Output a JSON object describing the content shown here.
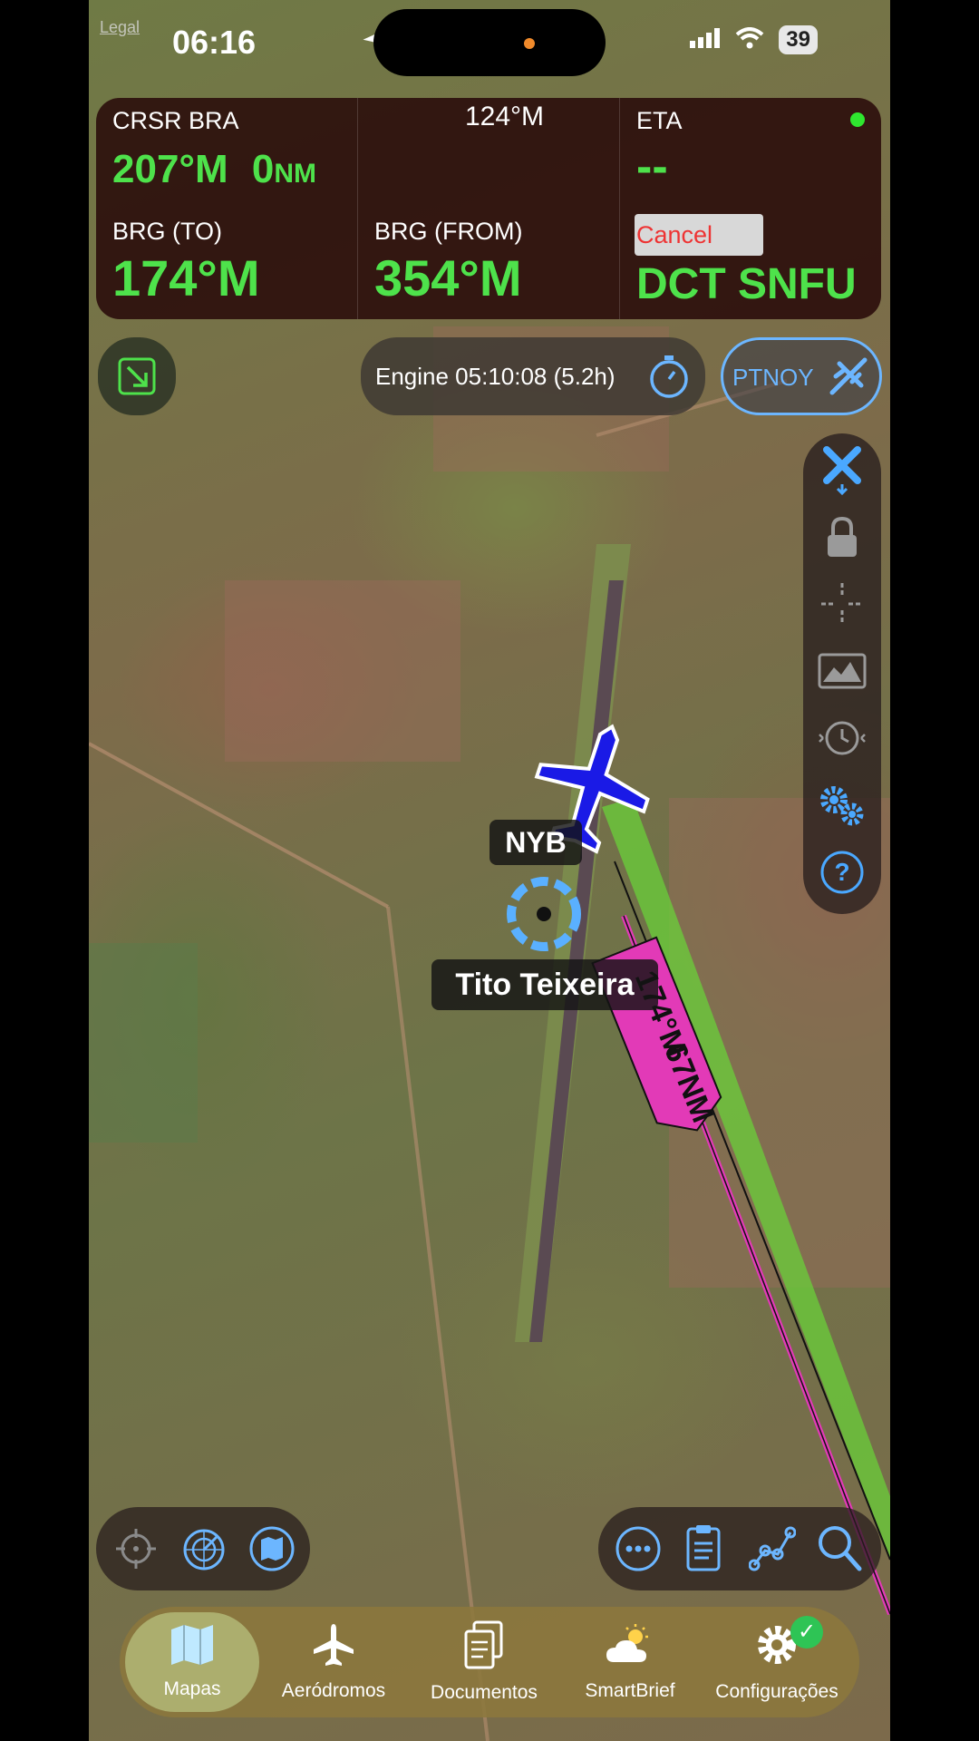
{
  "status_bar": {
    "legal": "Legal",
    "time": "06:16",
    "battery": "39"
  },
  "panel": {
    "crsr_label": "CRSR BRA",
    "crsr_value": "207°M",
    "crsr_distance": "0",
    "crsr_distance_unit": "NM",
    "heading": "124°M",
    "eta_label": "ETA",
    "eta_value": "--",
    "brg_to_label": "BRG (TO)",
    "brg_to_value": "174°M",
    "brg_from_label": "BRG (FROM)",
    "brg_from_value": "354°M",
    "cancel_label": "Cancel",
    "destination": "DCT SNFU"
  },
  "engine_timer": "Engine 05:10:08 (5.2h)",
  "aircraft_id": "PTNOY",
  "map": {
    "aircraft_label": "NYB",
    "airport_label": "Tito Teixeira",
    "route_label_bearing": "174°M",
    "route_label_distance": "67NM",
    "colors": {
      "route": "#e23ab7",
      "track": "#6ad03a",
      "aircraft": "#1a1ae6"
    }
  },
  "right_tools": [
    "close-x-icon",
    "lock-icon",
    "crosshair-icon",
    "terrain-icon",
    "history-clock-icon",
    "settings-gears-icon",
    "help-icon"
  ],
  "tabs": [
    {
      "label": "Mapas",
      "icon": "map-icon",
      "active": true
    },
    {
      "label": "Aeródromos",
      "icon": "airplane-icon",
      "active": false
    },
    {
      "label": "Documentos",
      "icon": "documents-icon",
      "active": false
    },
    {
      "label": "SmartBrief",
      "icon": "weather-icon",
      "active": false
    },
    {
      "label": "Configurações",
      "icon": "gear-icon",
      "active": false,
      "badge": "✓"
    }
  ]
}
